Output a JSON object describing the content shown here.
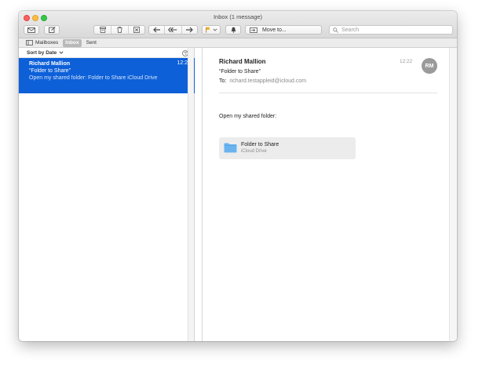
{
  "window": {
    "title": "Inbox (1 message)"
  },
  "toolbar": {
    "buttons": [
      {
        "name": "get-mail",
        "icon": "envelope-icon"
      },
      {
        "name": "compose",
        "icon": "compose-icon"
      },
      {
        "name": "archive",
        "icon": "archive-icon"
      },
      {
        "name": "delete",
        "icon": "trash-icon"
      },
      {
        "name": "junk",
        "icon": "junk-icon"
      },
      {
        "name": "reply",
        "icon": "reply-icon"
      },
      {
        "name": "reply-all",
        "icon": "reply-all-icon"
      },
      {
        "name": "forward",
        "icon": "forward-icon"
      },
      {
        "name": "flag",
        "icon": "flag-icon"
      },
      {
        "name": "mute",
        "icon": "bell-icon"
      }
    ],
    "move_to_label": "Move to...",
    "search_placeholder": "Search",
    "flag_color": "#f5a623"
  },
  "favorites": {
    "mailboxes_label": "Mailboxes",
    "inbox_label": "Inbox",
    "sent_label": "Sent"
  },
  "message_list": {
    "sort_label": "Sort by Date",
    "selected_color": "#0d60d8",
    "messages": [
      {
        "sender": "Richard Mallion",
        "time": "12:22",
        "subject": "“Folder to Share”",
        "preview": "Open my shared folder: Folder to Share iCloud Drive"
      }
    ]
  },
  "reader": {
    "sender": "Richard Mallion",
    "subject": "“Folder to Share”",
    "to_label": "To:",
    "to_address": "richard.testappleid@icloud.com",
    "time": "12:22",
    "avatar_initials": "RM",
    "body": "Open my shared folder:",
    "attachment": {
      "name": "Folder to Share",
      "location": "iCloud Drive",
      "icon": "folder-icon",
      "icon_color": "#6ab3ef"
    }
  }
}
